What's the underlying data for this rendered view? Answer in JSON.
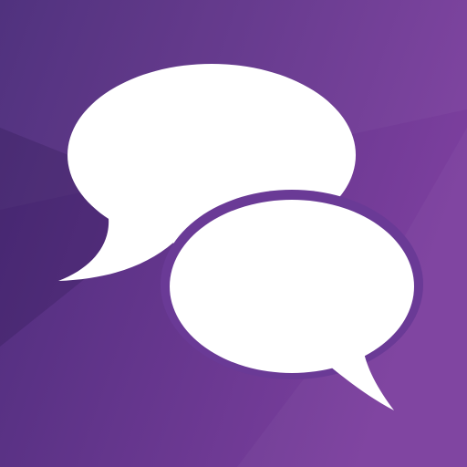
{
  "icon": {
    "name": "chat-bubbles-icon",
    "colors": {
      "background_left": "#4b2c7a",
      "background_right": "#7c3f9e",
      "bubble_fill": "#ffffff",
      "bubble_outline": "#6a3a96",
      "shadow": "#3f2668"
    }
  }
}
